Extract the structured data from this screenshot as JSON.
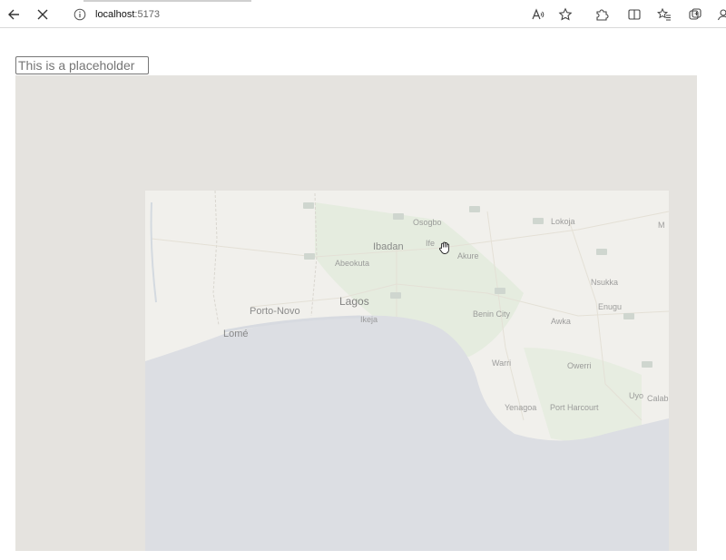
{
  "browser": {
    "url_host": "localhost",
    "url_port": ":5173",
    "icons": [
      "back-arrow-icon",
      "stop-loading-icon",
      "site-info-icon",
      "read-aloud-icon",
      "favorite-star-icon",
      "extensions-icon",
      "split-screen-icon",
      "favorites-icon",
      "collections-icon",
      "profile-icon"
    ]
  },
  "search": {
    "placeholder": "This is a placeholder",
    "value": ""
  },
  "map": {
    "colors": {
      "land": "#f1f0ec",
      "water": "#dcdee3",
      "blank": "#e5e3df",
      "green": "#e3ebdc"
    },
    "labels": {
      "ibadan": "Ibadan",
      "osogbo": "Osogbo",
      "ife": "Ife",
      "akure": "Akure",
      "abeokuta": "Abeokuta",
      "lagos": "Lagos",
      "ikeja": "Ikeja",
      "porto_novo": "Porto-Novo",
      "lome": "Lomé",
      "benin_city": "Benin City",
      "warri": "Warri",
      "owerri": "Owerri",
      "port_harcourt": "Port Harcourt",
      "yenagoa": "Yenagoa",
      "uyo": "Uyo",
      "calabar": "Calab",
      "enugu": "Enugu",
      "nsukka": "Nsukka",
      "awka": "Awka",
      "lokoja": "Lokoja",
      "ma": "M"
    }
  }
}
